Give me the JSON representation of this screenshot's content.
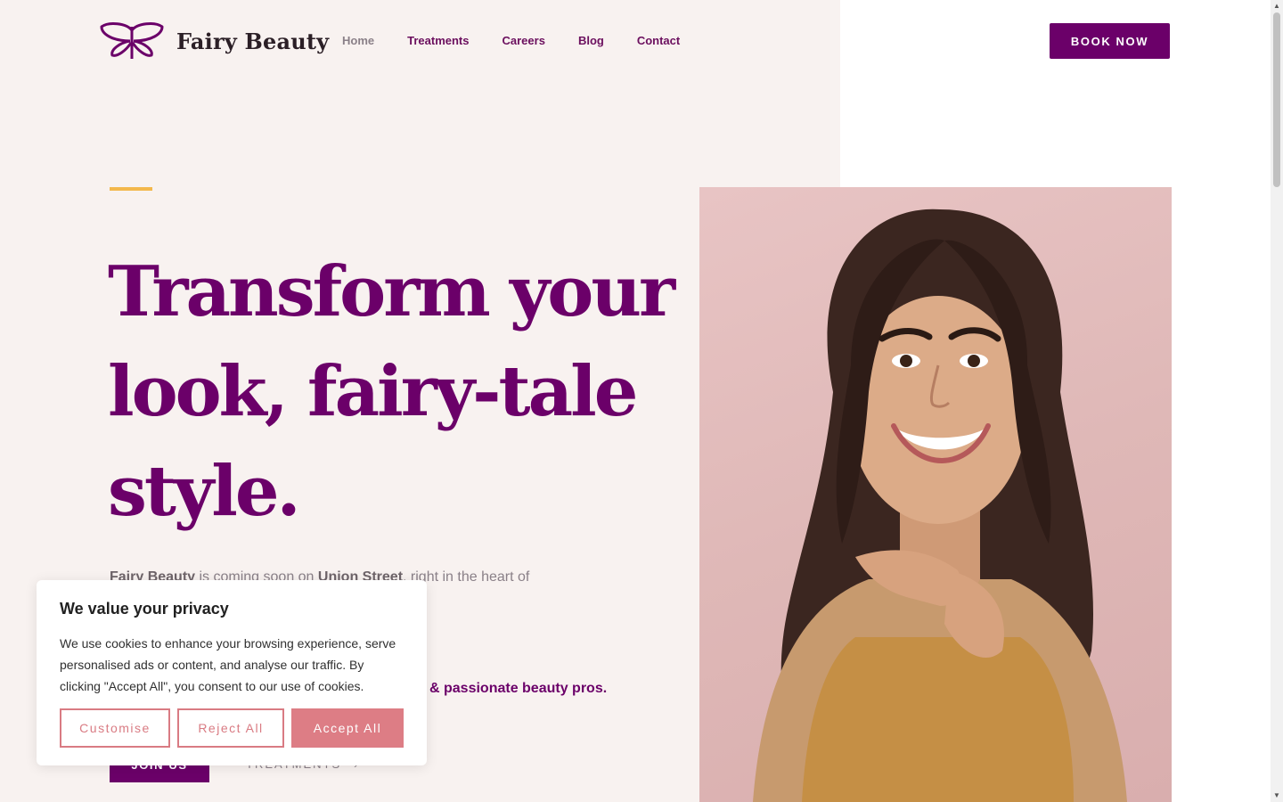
{
  "brand": {
    "name": "Fairy Beauty",
    "logo_icon": "butterfly-icon",
    "color": "#6b0069"
  },
  "nav": {
    "items": [
      {
        "label": "Home",
        "active": true
      },
      {
        "label": "Treatments",
        "active": false
      },
      {
        "label": "Careers",
        "active": false
      },
      {
        "label": "Blog",
        "active": false
      },
      {
        "label": "Contact",
        "active": false
      }
    ]
  },
  "header": {
    "book_label": "BOOK NOW"
  },
  "hero": {
    "title": "Transform your look, fairy-tale style.",
    "intro_brand": "Fairy Beauty",
    "intro_mid": " is coming soon on ",
    "intro_street": "Union Street",
    "intro_end": ", right in the heart of",
    "tagline": "& passionate beauty pros.",
    "join_label": "JOIN US",
    "treatments_label": "TREATMENTS",
    "accent_color": "#f3b84c"
  },
  "cookie": {
    "title": "We value your privacy",
    "body": "We use cookies to enhance your browsing experience, serve personalised ads or content, and analyse our traffic. By clicking \"Accept All\", you consent to our use of cookies.",
    "customise_label": "Customise",
    "reject_label": "Reject All",
    "accept_label": "Accept All",
    "accent_color": "#dd7d85"
  }
}
